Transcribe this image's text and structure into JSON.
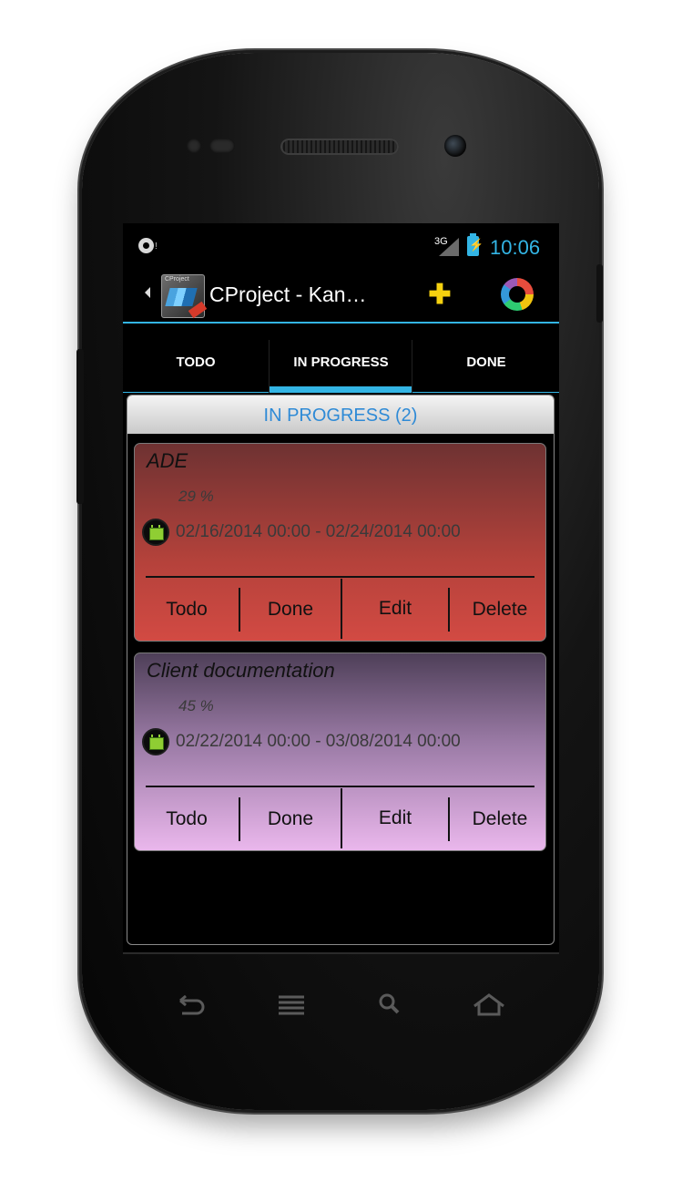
{
  "status_bar": {
    "network": "3G",
    "time": "10:06"
  },
  "action_bar": {
    "app_icon_label": "CProject",
    "title": "CProject - Kan…",
    "add_icon": "plus-icon",
    "chart_icon": "donut-chart-icon",
    "accent_color": "#33b5e5"
  },
  "tabs": [
    {
      "label": "TODO"
    },
    {
      "label": "IN PROGRESS",
      "selected": true
    },
    {
      "label": "DONE"
    }
  ],
  "panel": {
    "header": "IN PROGRESS (2)"
  },
  "cards": [
    {
      "title": "ADE",
      "progress": "29 %",
      "dates": "02/16/2014 00:00 - 02/24/2014 00:00",
      "color": "#c9463f",
      "actions": {
        "todo": "Todo",
        "done": "Done",
        "edit": "Edit",
        "delete": "Delete"
      }
    },
    {
      "title": "Client documentation",
      "progress": "45 %",
      "dates": "02/22/2014 00:00 - 03/08/2014 00:00",
      "color": "#d8a5dc",
      "actions": {
        "todo": "Todo",
        "done": "Done",
        "edit": "Edit",
        "delete": "Delete"
      }
    }
  ],
  "nav_keys": [
    {
      "icon": "back-icon"
    },
    {
      "icon": "menu-icon"
    },
    {
      "icon": "search-icon"
    },
    {
      "icon": "home-icon"
    }
  ]
}
